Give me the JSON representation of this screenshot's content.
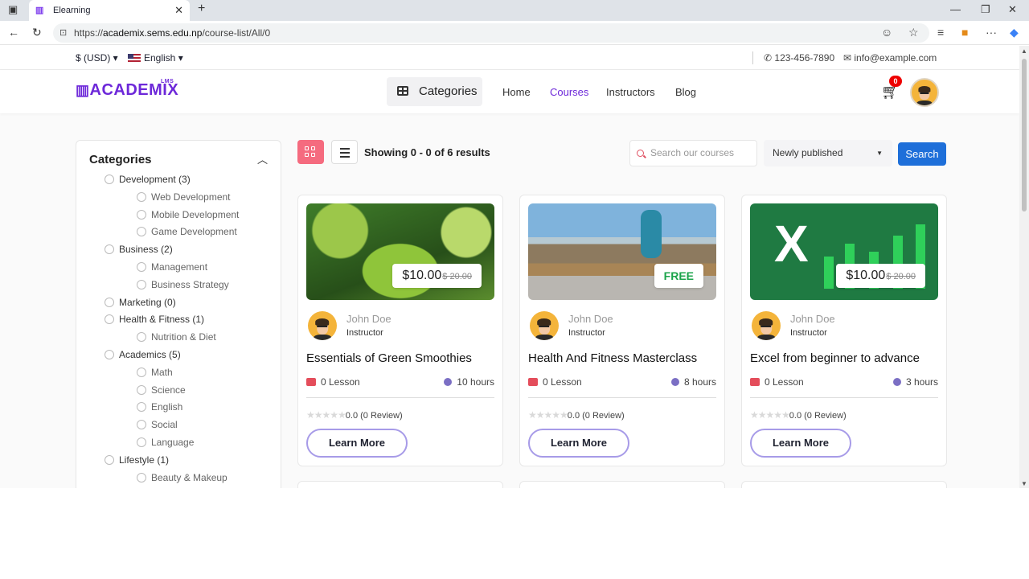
{
  "browser": {
    "tab_title": "Elearning",
    "url_prefix": "https://",
    "url_host": "academix.sems.edu.np",
    "url_path": "/course-list/All/0"
  },
  "topbar": {
    "currency": "$ (USD) ▾",
    "language": "English ▾",
    "phone": "123-456-7890",
    "email": "info@example.com"
  },
  "header": {
    "logo_text": "ACADEMIX",
    "logo_sup": "LMS",
    "categories_button": "Categories",
    "nav": [
      "Home",
      "Courses",
      "Instructors",
      "Blog"
    ],
    "cart_count": "0"
  },
  "sidebar": {
    "title": "Categories",
    "items": [
      {
        "label": "Development (3)",
        "level": 0
      },
      {
        "label": "Web Development",
        "level": 1
      },
      {
        "label": "Mobile Development",
        "level": 1
      },
      {
        "label": "Game Development",
        "level": 1
      },
      {
        "label": "Business (2)",
        "level": 0
      },
      {
        "label": "Management",
        "level": 1
      },
      {
        "label": "Business Strategy",
        "level": 1
      },
      {
        "label": "Marketing (0)",
        "level": 0
      },
      {
        "label": "Health & Fitness (1)",
        "level": 0
      },
      {
        "label": "Nutrition & Diet",
        "level": 1
      },
      {
        "label": "Academics (5)",
        "level": 0
      },
      {
        "label": "Math",
        "level": 1
      },
      {
        "label": "Science",
        "level": 1
      },
      {
        "label": "English",
        "level": 1
      },
      {
        "label": "Social",
        "level": 1
      },
      {
        "label": "Language",
        "level": 1
      },
      {
        "label": "Lifestyle (1)",
        "level": 0
      },
      {
        "label": "Beauty & Makeup",
        "level": 1
      }
    ]
  },
  "toolbar": {
    "showing": "Showing 0 - 0 of 6 results",
    "search_placeholder": "Search our courses",
    "sort_value": "Newly published",
    "search_button": "Search"
  },
  "courses": [
    {
      "price": "$10.00",
      "old_price": "$ 20.00",
      "instructor": "John Doe",
      "role": "Instructor",
      "title": "Essentials of Green Smoothies",
      "lessons": "0 Lesson",
      "hours": "10 hours",
      "rating": "0.0 (0 Review)",
      "button": "Learn More"
    },
    {
      "price": "FREE",
      "old_price": "",
      "instructor": "John Doe",
      "role": "Instructor",
      "title": "Health And Fitness Masterclass",
      "lessons": "0 Lesson",
      "hours": "8 hours",
      "rating": "0.0 (0 Review)",
      "button": "Learn More"
    },
    {
      "price": "$10.00",
      "old_price": "$ 20.00",
      "instructor": "John Doe",
      "role": "Instructor",
      "title": "Excel from beginner to advance",
      "lessons": "0 Lesson",
      "hours": "3 hours",
      "rating": "0.0 (0 Review)",
      "button": "Learn More"
    }
  ],
  "colors": {
    "brand": "#6d28d9",
    "accent_pink": "#f56b7f",
    "search_blue": "#1e6fd9",
    "free_green": "#1aa34a"
  }
}
